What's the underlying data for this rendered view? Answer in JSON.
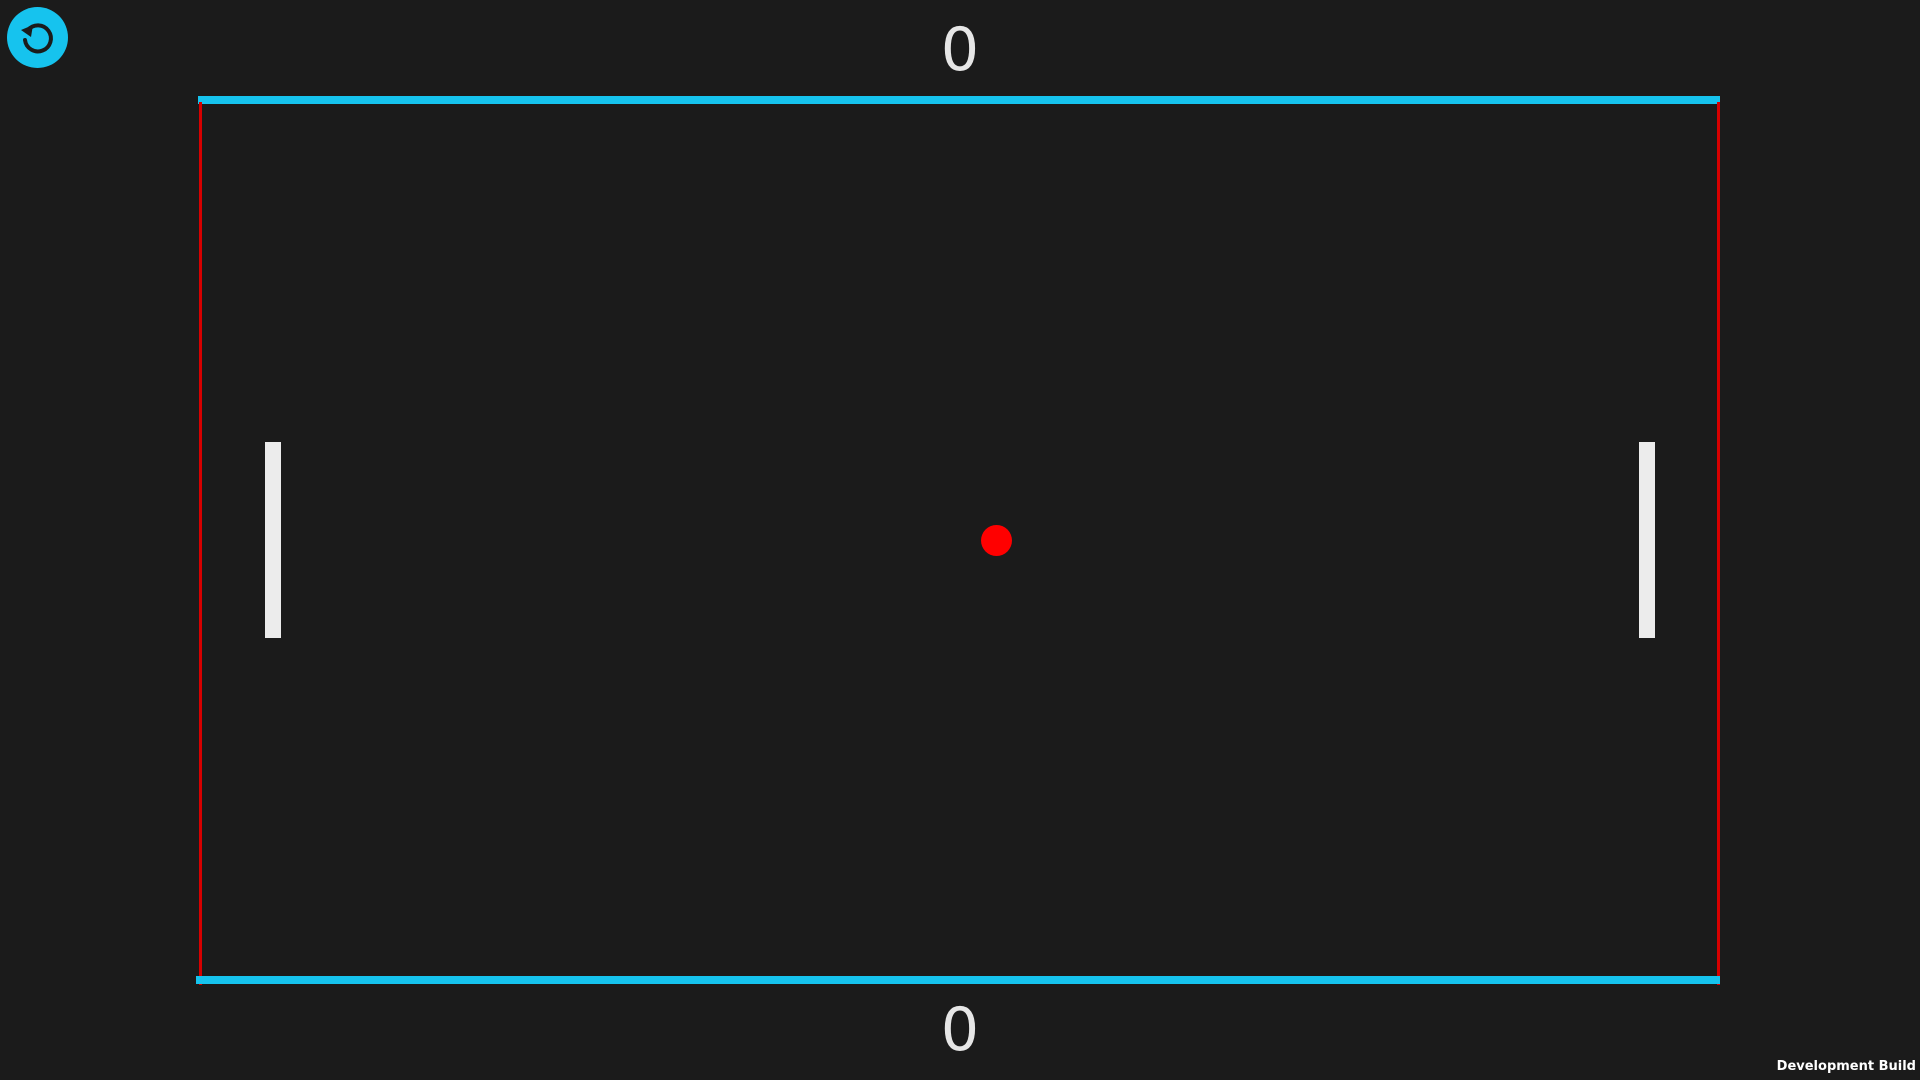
{
  "scores": {
    "top": "0",
    "bottom": "0"
  },
  "reset_button": {
    "icon": "reset-icon"
  },
  "footer": {
    "build_label": "Development Build"
  },
  "colors": {
    "background": "#1b1b1b",
    "walls": "#16c3ee",
    "goals": "#d70000",
    "paddles": "#ececec",
    "ball": "#ff0000",
    "score_text": "#e6e6e6"
  }
}
